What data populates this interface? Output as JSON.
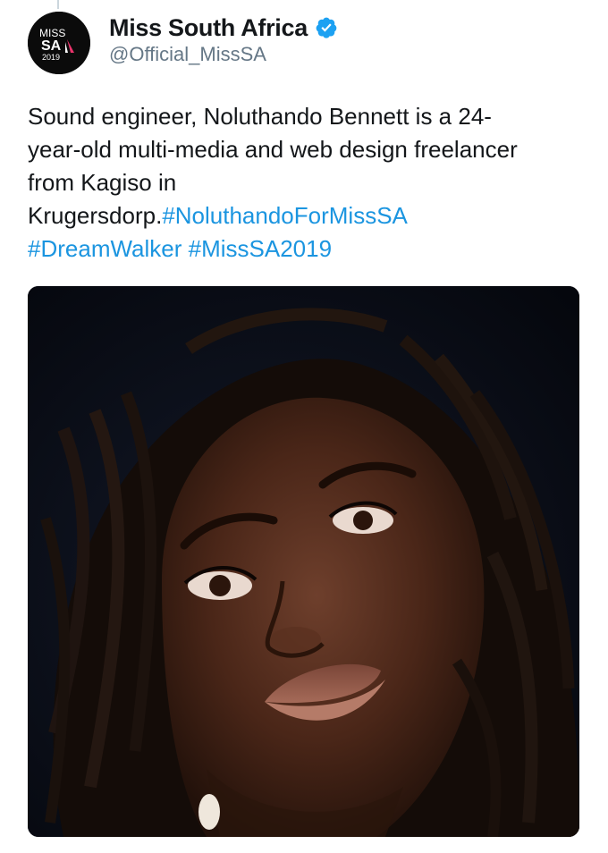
{
  "tweet": {
    "display_name": "Miss South Africa",
    "handle": "@Official_MissSA",
    "verified": true,
    "avatar": {
      "line1": "MISS",
      "line2": "SA",
      "line3": "2019",
      "icon": "miss-sa-logo"
    },
    "text_lines": [
      {
        "plain": "Sound engineer, Noluthando Bennett is a 24-",
        "tags": []
      },
      {
        "plain": "year-old multi-media and web design freelancer",
        "tags": []
      },
      {
        "plain": "from Kagiso in",
        "tags": []
      },
      {
        "plain": "Krugersdorp.",
        "tags": [
          "#NoluthandoForMissSA"
        ]
      },
      {
        "plain": "",
        "tags": [
          "#DreamWalker",
          "#MissSA2019"
        ]
      }
    ],
    "media": {
      "icon": "portrait-photo"
    }
  },
  "colors": {
    "link": "#1b95e0",
    "verified": "#1da1f2",
    "handle": "#657786",
    "text": "#14171a",
    "avatar_accent": "#e8336b"
  }
}
